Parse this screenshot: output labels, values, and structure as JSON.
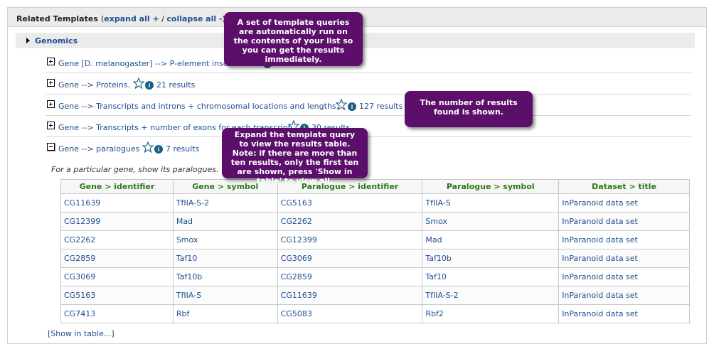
{
  "panel": {
    "title": "Related Templates",
    "expand_open": "(",
    "expand_all": "expand all +",
    "sep": " / ",
    "collapse_all": "collapse all -",
    "expand_close": ")"
  },
  "category": {
    "label": "Genomics"
  },
  "templates": [
    {
      "name": "Gene [D. melanogaster] --> P-element inser",
      "results": ""
    },
    {
      "name": "Gene --> Proteins.",
      "results": "21 results"
    },
    {
      "name": "Gene --> Transcripts and introns + chromosomal locations and lengths.",
      "results": "127 results"
    },
    {
      "name": "Gene --> Transcripts + number of exons for each transcript",
      "results": "30 results"
    },
    {
      "name": "Gene --> paralogues",
      "results": "7 results"
    }
  ],
  "expanded": {
    "description": "For a particular gene, show its paralogues.",
    "columns": [
      "Gene > identifier",
      "Gene > symbol",
      "Paralogue > identifier",
      "Paralogue > symbol",
      "Dataset > title"
    ],
    "rows": [
      [
        "CG11639",
        "TfIIA-S-2",
        "CG5163",
        "TfIIA-S",
        "InParanoid data set"
      ],
      [
        "CG12399",
        "Mad",
        "CG2262",
        "Smox",
        "InParanoid data set"
      ],
      [
        "CG2262",
        "Smox",
        "CG12399",
        "Mad",
        "InParanoid data set"
      ],
      [
        "CG2859",
        "Taf10",
        "CG3069",
        "Taf10b",
        "InParanoid data set"
      ],
      [
        "CG3069",
        "Taf10b",
        "CG2859",
        "Taf10",
        "InParanoid data set"
      ],
      [
        "CG5163",
        "TfIIA-S",
        "CG11639",
        "TfIIA-S-2",
        "InParanoid data set"
      ],
      [
        "CG7413",
        "Rbf",
        "CG5083",
        "Rbf2",
        "InParanoid data set"
      ]
    ],
    "show_in_table": "[Show in table...]"
  },
  "callouts": {
    "one": "A set of template queries are automatically run on the contents of your list so you can get the results immediately.",
    "two": "The number of results found is shown.",
    "three": "Expand the template query to view the results table. Note: if there are more than ten results, only the first ten are shown, press 'Show in table' to view all."
  },
  "colors": {
    "link": "#1f4f8f",
    "header_green": "#2a7a18",
    "callout": "#5b0e6a",
    "info_icon": "#1a5e86"
  },
  "icons": {
    "favourite": "star-icon",
    "info": "info-icon",
    "expand": "plus-box-icon",
    "collapse": "minus-box-icon"
  }
}
